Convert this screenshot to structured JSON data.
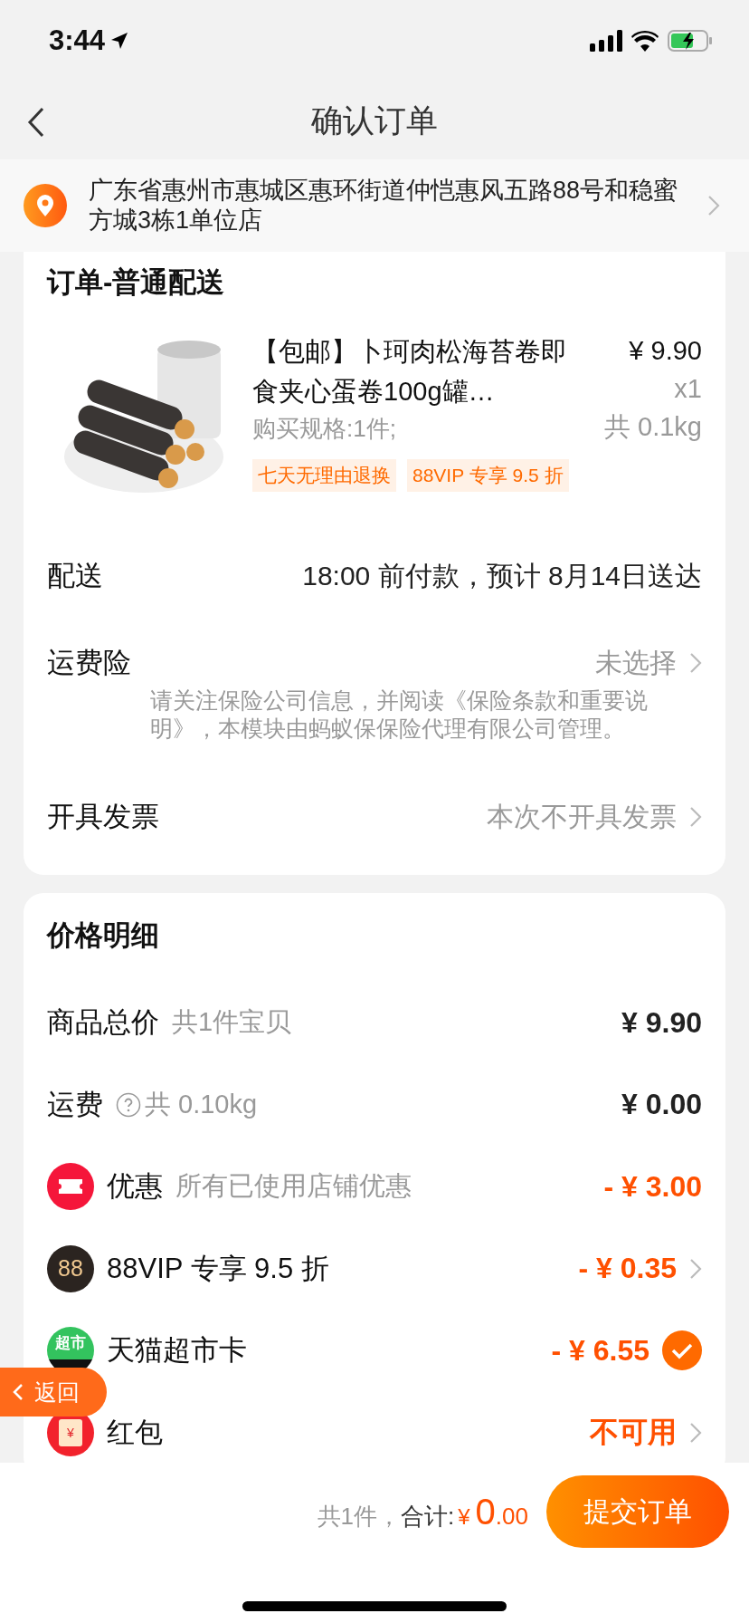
{
  "status_bar": {
    "time": "3:44"
  },
  "nav": {
    "title": "确认订单"
  },
  "address": {
    "text": "广东省惠州市惠城区惠环街道仲恺惠风五路88号和稳蜜方城3栋1单位店"
  },
  "order": {
    "title": "订单-普通配送",
    "product": {
      "name": "【包邮】卜珂肉松海苔卷即食夹心蛋卷100g罐…",
      "spec": "购买规格:1件;",
      "price": "¥ 9.90",
      "quantity": "x1",
      "weight": "共 0.1kg",
      "tags": [
        "七天无理由退换",
        "88VIP 专享 9.5 折"
      ]
    },
    "rows": [
      {
        "kind": "plain",
        "label": "配送",
        "value": "18:00 前付款，预计 8月14日送达"
      },
      {
        "kind": "link",
        "label": "运费险",
        "value": "未选择",
        "note": "请关注保险公司信息，并阅读《保险条款和重要说明》，本模块由蚂蚁保保险代理有限公司管理。"
      },
      {
        "kind": "link",
        "label": "开具发票",
        "value": "本次不开具发票"
      }
    ]
  },
  "prices": {
    "title": "价格明细",
    "rows": [
      {
        "kind": "total",
        "label": "商品总价",
        "detail": "共1件宝贝",
        "amount": "¥ 9.90"
      },
      {
        "kind": "shipping",
        "label": "运费",
        "detail": "共 0.10kg",
        "amount": "¥ 0.00"
      },
      {
        "kind": "coupon",
        "label": "优惠",
        "detail": "所有已使用店铺优惠",
        "amount": "- ¥ 3.00"
      },
      {
        "kind": "vip",
        "icon_text": "88",
        "label": "88VIP 专享 9.5 折",
        "amount": "- ¥ 0.35",
        "chevron": true
      },
      {
        "kind": "market",
        "icon_text": "超市",
        "label": "天猫超市卡",
        "amount": "- ¥ 6.55",
        "checked": true
      },
      {
        "kind": "packet",
        "icon_text": "¥",
        "label": "红包",
        "amount": "不可用",
        "chevron": true
      }
    ]
  },
  "bottom_bar": {
    "count": "共1件，",
    "total_label": "合计:",
    "currency": "¥",
    "amount_int": "0",
    "amount_dec": ".00",
    "submit": "提交订单"
  },
  "float_back": {
    "label": "返回"
  }
}
